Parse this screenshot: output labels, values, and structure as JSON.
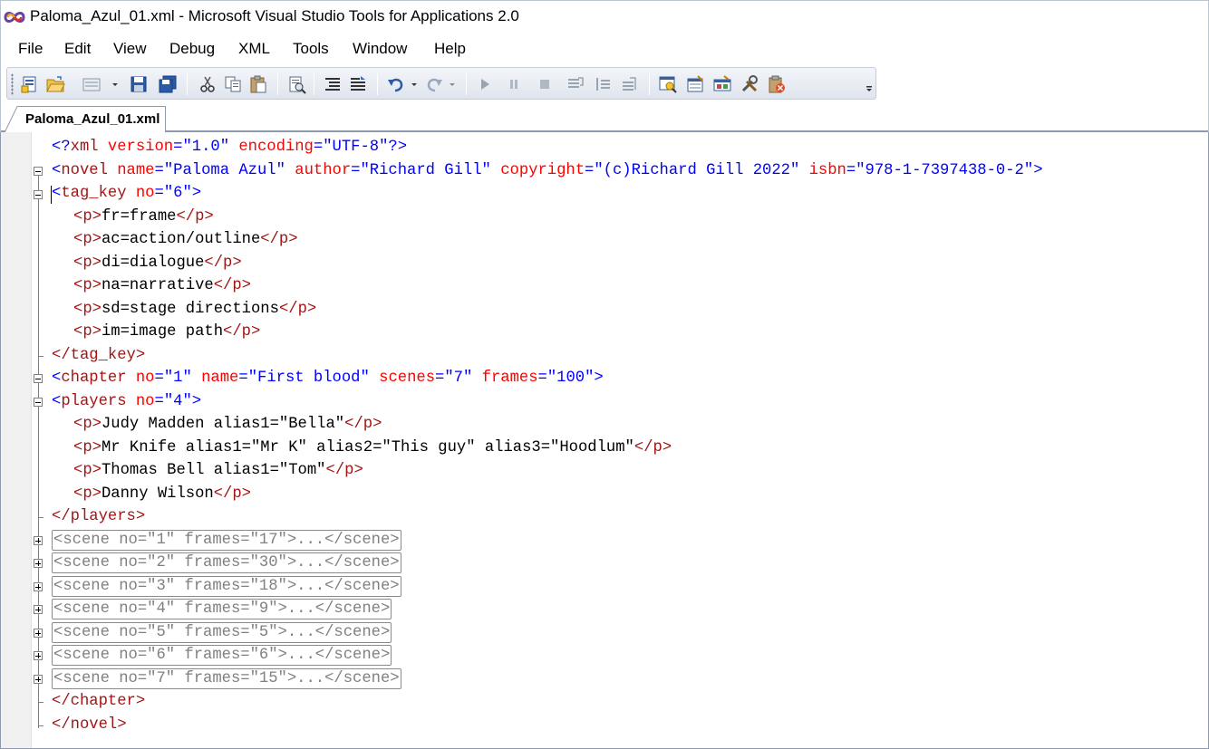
{
  "window": {
    "title": "Paloma_Azul_01.xml - Microsoft Visual Studio Tools for Applications 2.0"
  },
  "menu": [
    "File",
    "Edit",
    "View",
    "Debug",
    "XML",
    "Tools",
    "Window",
    "Help"
  ],
  "toolbar": {
    "buttons": [
      "new-project-icon",
      "open-folder-icon",
      "add-item-icon",
      "save-icon",
      "save-all-icon",
      "cut-icon",
      "copy-icon",
      "paste-icon",
      "find-icon",
      "format-document-icon",
      "comment-icon",
      "undo-icon",
      "redo-icon",
      "start-debug-icon",
      "pause-icon",
      "stop-icon",
      "step-into-icon",
      "step-over-icon",
      "step-out-icon",
      "object-browser-icon",
      "properties-icon",
      "toolbox-icon",
      "tools-icon",
      "clipboard-error-icon"
    ]
  },
  "tabs": [
    {
      "label": "Paloma_Azul_01.xml",
      "active": true
    }
  ],
  "editor": {
    "xml_decl": {
      "open": "<?",
      "name": "xml",
      "attrs": [
        {
          "name": "version",
          "value": "\"1.0\""
        },
        {
          "name": "encoding",
          "value": "\"UTF-8\""
        }
      ],
      "close": "?>"
    },
    "novel": {
      "tag": "novel",
      "attrs": [
        {
          "name": "name",
          "value": "\"Paloma Azul\""
        },
        {
          "name": "author",
          "value": "\"Richard Gill\""
        },
        {
          "name": "copyright",
          "value": "\"(c)Richard Gill 2022\""
        },
        {
          "name": "isbn",
          "value": "\"978-1-7397438-0-2\""
        }
      ]
    },
    "tag_key": {
      "tag": "tag_key",
      "attr_name": "no",
      "attr_value": "\"6\"",
      "items": [
        "fr=frame",
        "ac=action/outline",
        "di=dialogue",
        "na=narrative",
        "sd=stage directions",
        "im=image path"
      ],
      "close": "</tag_key>"
    },
    "chapter": {
      "tag": "chapter",
      "attrs": [
        {
          "name": "no",
          "value": "\"1\""
        },
        {
          "name": "name",
          "value": "\"First blood\""
        },
        {
          "name": "scenes",
          "value": "\"7\""
        },
        {
          "name": "frames",
          "value": "\"100\""
        }
      ],
      "close": "</chapter>"
    },
    "players": {
      "tag": "players",
      "attr_name": "no",
      "attr_value": "\"4\"",
      "items": [
        "Judy Madden alias1=\"Bella\"",
        "Mr Knife alias1=\"Mr K\" alias2=\"This guy\" alias3=\"Hoodlum\"",
        "Thomas Bell alias1=\"Tom\"",
        "Danny Wilson"
      ],
      "close": "</players>"
    },
    "p_open": "<p>",
    "p_close": "</p>",
    "scenes": [
      "<scene no=\"1\" frames=\"17\">...</scene>",
      "<scene no=\"2\" frames=\"30\">...</scene>",
      "<scene no=\"3\" frames=\"18\">...</scene>",
      "<scene no=\"4\" frames=\"9\">...</scene>",
      "<scene no=\"5\" frames=\"5\">...</scene>",
      "<scene no=\"6\" frames=\"6\">...</scene>",
      "<scene no=\"7\" frames=\"15\">...</scene>"
    ],
    "novel_close": "</novel>"
  },
  "colors": {
    "tag": "#a31515",
    "attribute": "#ff0000",
    "value": "#0000ff",
    "punctuation": "#0000ff",
    "text": "#000000",
    "collapsed": "#808080"
  }
}
